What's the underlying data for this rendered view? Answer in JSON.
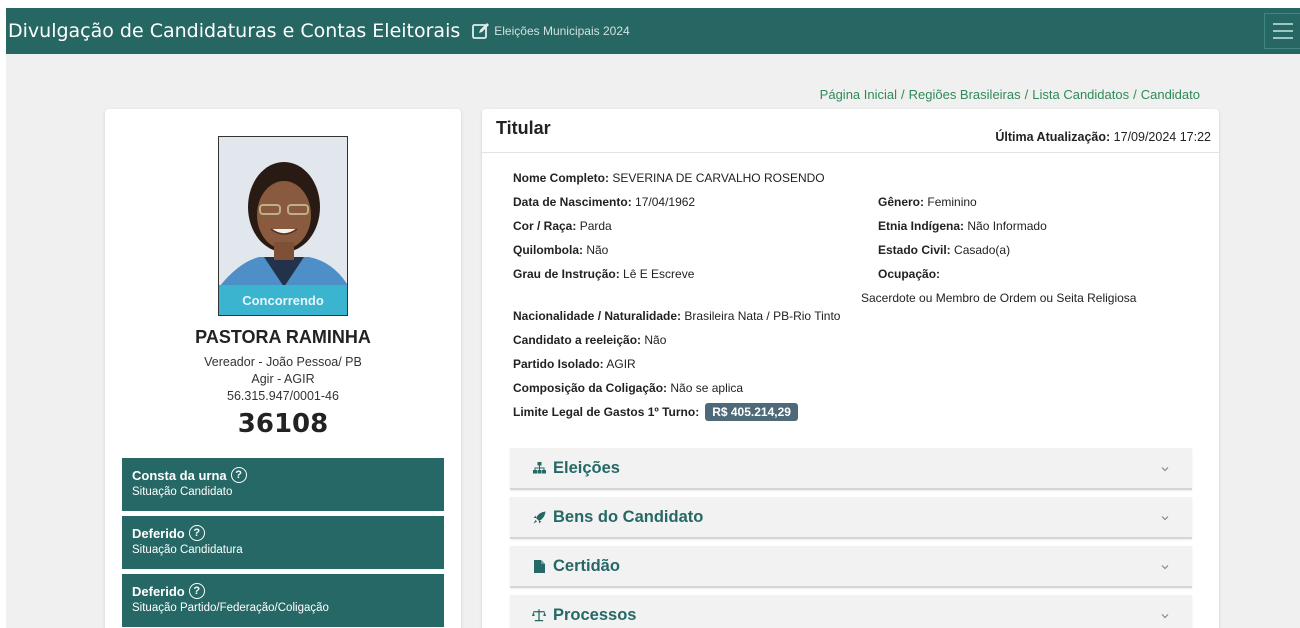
{
  "header": {
    "title": "Divulgação de Candidaturas e Contas Eleitorais",
    "subtitle": "Eleições Municipais 2024",
    "accent_color": "#266763",
    "icons": {
      "edit": "edit-icon",
      "menu": "hamburger-menu-icon"
    }
  },
  "breadcrumb": [
    "Página Inicial",
    "Regiões Brasileiras",
    "Lista Candidatos",
    "Candidato"
  ],
  "candidate": {
    "status": "Concorrendo",
    "name": "PASTORA RAMINHA",
    "office": "Vereador - João Pessoa/ PB",
    "party": "Agir - AGIR",
    "cnpj": "56.315.947/0001-46",
    "number": "36108"
  },
  "situations": [
    {
      "title": "Consta da urna",
      "subtitle": "Situação Candidato"
    },
    {
      "title": "Deferido",
      "subtitle": "Situação Candidatura"
    },
    {
      "title": "Deferido",
      "subtitle": "Situação Partido/Federação/Coligação"
    }
  ],
  "main": {
    "title": "Titular",
    "updated_label": "Última Atualização:",
    "updated_value": "17/09/2024 17:22",
    "fields": {
      "nome_label": "Nome Completo:",
      "nome": "SEVERINA DE CARVALHO ROSENDO",
      "nasc_label": "Data de Nascimento:",
      "nasc": "17/04/1962",
      "genero_label": "Gênero:",
      "genero": "Feminino",
      "cor_label": "Cor / Raça:",
      "cor": "Parda",
      "etnia_label": "Etnia Indígena:",
      "etnia": "Não Informado",
      "quilombola_label": "Quilombola:",
      "quilombola": "Não",
      "civil_label": "Estado Civil:",
      "civil": "Casado(a)",
      "instrucao_label": "Grau de Instrução:",
      "instrucao": "Lê E Escreve",
      "ocupacao_label": "Ocupação:",
      "ocupacao": "Sacerdote ou Membro de Ordem ou Seita Religiosa",
      "nacionalidade_label": "Nacionalidade / Naturalidade:",
      "nacionalidade": "Brasileira Nata / PB-Rio Tinto",
      "reeleicao_label": "Candidato a reeleição:",
      "reeleicao": "Não",
      "partido_label": "Partido Isolado:",
      "partido": "AGIR",
      "coligacao_label": "Composição da Coligação:",
      "coligacao": "Não se aplica",
      "limite_label": "Limite Legal de Gastos 1º Turno:",
      "limite": "R$ 405.214,29"
    },
    "accordions": [
      {
        "label": "Eleições",
        "icon": "sitemap-icon"
      },
      {
        "label": "Bens do Candidato",
        "icon": "rocket-icon"
      },
      {
        "label": "Certidão",
        "icon": "file-icon"
      },
      {
        "label": "Processos",
        "icon": "balance-scale-icon"
      }
    ]
  }
}
